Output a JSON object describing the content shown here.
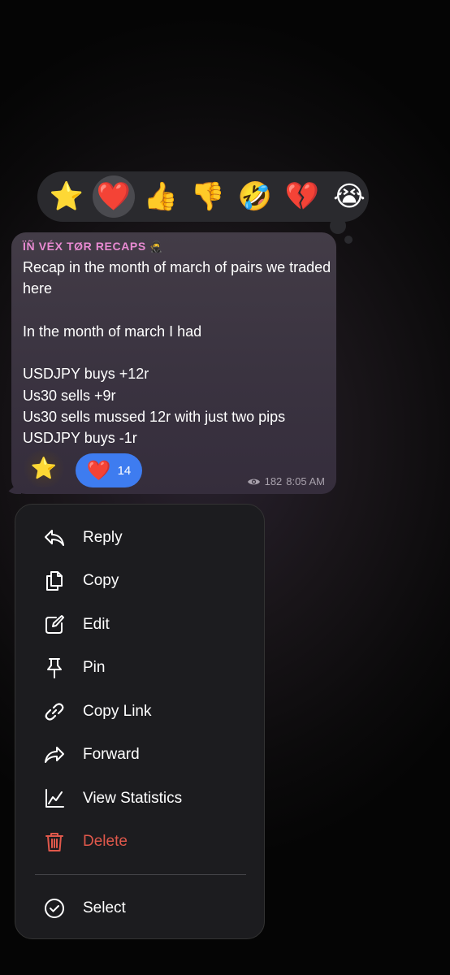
{
  "reactions": [
    {
      "name": "star-emoji",
      "glyph": "⭐"
    },
    {
      "name": "red-heart-emoji",
      "glyph": "❤️"
    },
    {
      "name": "thumbs-up-emoji",
      "glyph": "👍"
    },
    {
      "name": "thumbs-down-emoji",
      "glyph": "👎"
    },
    {
      "name": "rolling-laughing-emoji",
      "glyph": "🤣"
    },
    {
      "name": "broken-heart-emoji",
      "glyph": "💔"
    },
    {
      "name": "crying-emoji",
      "glyph": "😭"
    }
  ],
  "message": {
    "sender": "ÏÑ VÉX TØR RECAPS",
    "sender_icon": "🥷",
    "text": "Recap in the month of march of pairs we traded here\n\nIn the month of march I had\n\nUSDJPY buys  +12r\nUs30 sells +9r\nUs30 sells mussed 12r with just two pips\nUSDJPY buys -1r",
    "sticker": "⭐",
    "reaction": {
      "glyph": "❤️",
      "count": "14"
    },
    "views": "182",
    "time": "8:05 AM"
  },
  "menu": {
    "items": [
      {
        "key": "reply",
        "label": "Reply",
        "icon": "reply-icon"
      },
      {
        "key": "copy",
        "label": "Copy",
        "icon": "copy-icon"
      },
      {
        "key": "edit",
        "label": "Edit",
        "icon": "edit-icon"
      },
      {
        "key": "pin",
        "label": "Pin",
        "icon": "pin-icon"
      },
      {
        "key": "copy_link",
        "label": "Copy Link",
        "icon": "link-icon"
      },
      {
        "key": "forward",
        "label": "Forward",
        "icon": "forward-icon"
      },
      {
        "key": "view_statistics",
        "label": "View Statistics",
        "icon": "statistics-icon"
      },
      {
        "key": "delete",
        "label": "Delete",
        "icon": "trash-icon"
      },
      {
        "key": "select",
        "label": "Select",
        "icon": "checkmark-circle-icon"
      }
    ]
  },
  "colors": {
    "sender": "#e88ad2",
    "reaction_pill": "#3e7cf0",
    "danger": "#e0584b",
    "menu_bg": "#1c1c1f"
  }
}
